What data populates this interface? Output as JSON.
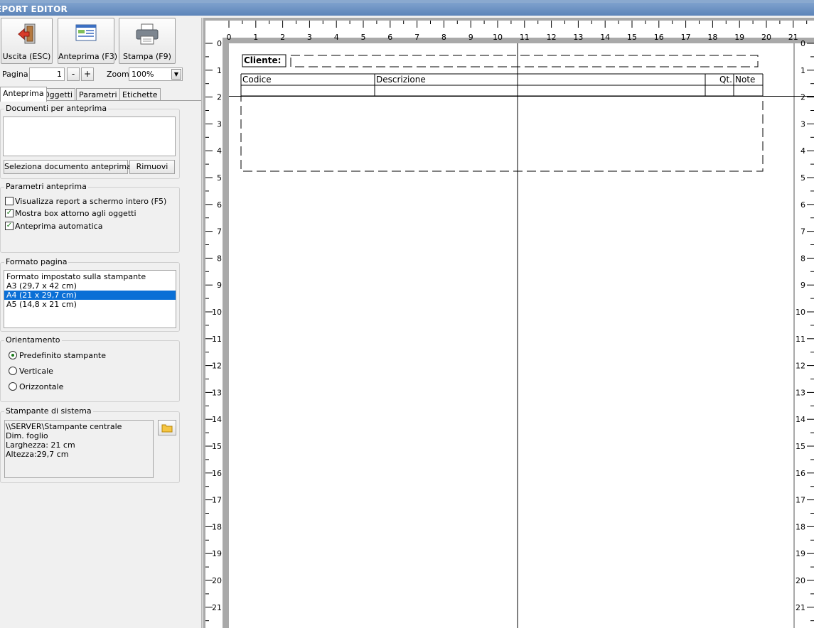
{
  "window": {
    "title": "EPORT EDITOR"
  },
  "toolbar": {
    "exit_label": "Uscita (ESC)",
    "preview_label": "Anteprima (F3)",
    "print_label": "Stampa (F9)"
  },
  "pager": {
    "page_label": "Pagina",
    "page_value": "1",
    "minus": "-",
    "plus": "+",
    "zoom_label": "Zoom",
    "zoom_value": "100%"
  },
  "tabs": [
    "Anteprima",
    "Oggetti",
    "Parametri",
    "Etichette"
  ],
  "documents": {
    "title": "Documenti per anteprima",
    "select_button": "Seleziona documento anteprima",
    "remove_button": "Rimuovi"
  },
  "preview_params": {
    "title": "Parametri anteprima",
    "options": [
      {
        "label": "Visualizza report a schermo intero (F5)",
        "checked": false
      },
      {
        "label": "Mostra box attorno agli oggetti",
        "checked": true
      },
      {
        "label": "Anteprima automatica",
        "checked": true
      }
    ]
  },
  "page_format": {
    "title": "Formato pagina",
    "items": [
      "Formato impostato sulla stampante",
      "A3 (29,7 x 42 cm)",
      "A4 (21 x 29,7 cm)",
      "A5 (14,8 x 21 cm)"
    ],
    "selected_index": 2
  },
  "orientation": {
    "title": "Orientamento",
    "options": [
      "Predefinito stampante",
      "Verticale",
      "Orizzontale"
    ],
    "selected_index": 0
  },
  "printer": {
    "title": "Stampante di sistema",
    "lines": [
      "\\\\SERVER\\Stampante centrale",
      "Dim. foglio",
      "Larghezza: 21 cm",
      "Altezza:29,7 cm"
    ]
  },
  "report": {
    "client_label": "Cliente:",
    "columns": [
      "Codice",
      "Descrizione",
      "Qt.",
      "Note"
    ]
  },
  "ruler": {
    "h_labels": [
      "0",
      "1",
      "2",
      "3",
      "4",
      "5",
      "6",
      "7",
      "8",
      "9",
      "10",
      "11",
      "12",
      "13",
      "14",
      "15",
      "16",
      "17",
      "18",
      "19",
      "20",
      "21"
    ],
    "v_labels": [
      "0",
      "1",
      "2",
      "3",
      "4",
      "5",
      "6",
      "7",
      "8",
      "9",
      "10",
      "11",
      "12",
      "13",
      "14",
      "15",
      "16",
      "17",
      "18",
      "19",
      "20",
      "21"
    ]
  },
  "colors": {
    "title_bar": "#5c84b9",
    "selection": "#0a6fd6",
    "check": "#1a7a1a"
  }
}
